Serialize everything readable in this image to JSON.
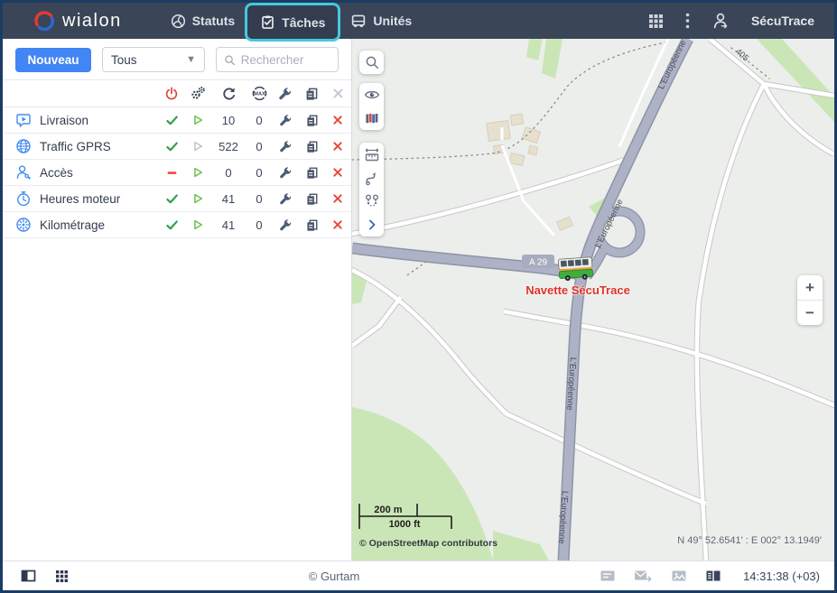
{
  "header": {
    "brand": "wialon",
    "tabs": {
      "statuses": "Statuts",
      "tasks": "Tâches",
      "units": "Unités"
    },
    "username": "SécuTrace"
  },
  "panel": {
    "new_button": "Nouveau",
    "filter_value": "Tous",
    "search_placeholder": "Rechercher",
    "rows": [
      {
        "label": "Livraison",
        "executions": "10",
        "queue": "0"
      },
      {
        "label": "Traffic GPRS",
        "executions": "522",
        "queue": "0"
      },
      {
        "label": "Accès",
        "executions": "0",
        "queue": "0"
      },
      {
        "label": "Heures moteur",
        "executions": "41",
        "queue": "0"
      },
      {
        "label": "Kilométrage",
        "executions": "41",
        "queue": "0"
      }
    ]
  },
  "map": {
    "unit_label": "Navette SécuTrace",
    "road_a29": "A 29",
    "road_europeenne": "L'Européenne",
    "road_405": "405",
    "scale_m": "200 m",
    "scale_ft": "1000 ft",
    "attribution": "© OpenStreetMap contributors",
    "coordinates": "N 49° 52.6541' : E 002° 13.1949'",
    "zoom_in": "+",
    "zoom_out": "−"
  },
  "footer": {
    "copyright": "© Gurtam",
    "time": "14:31:38 (+03)"
  },
  "colors": {
    "accent_blue": "#4285f4",
    "navbar": "#3a4557",
    "highlight_cyan": "#45c8de",
    "status_green": "#2da044",
    "status_red": "#e8483c"
  }
}
